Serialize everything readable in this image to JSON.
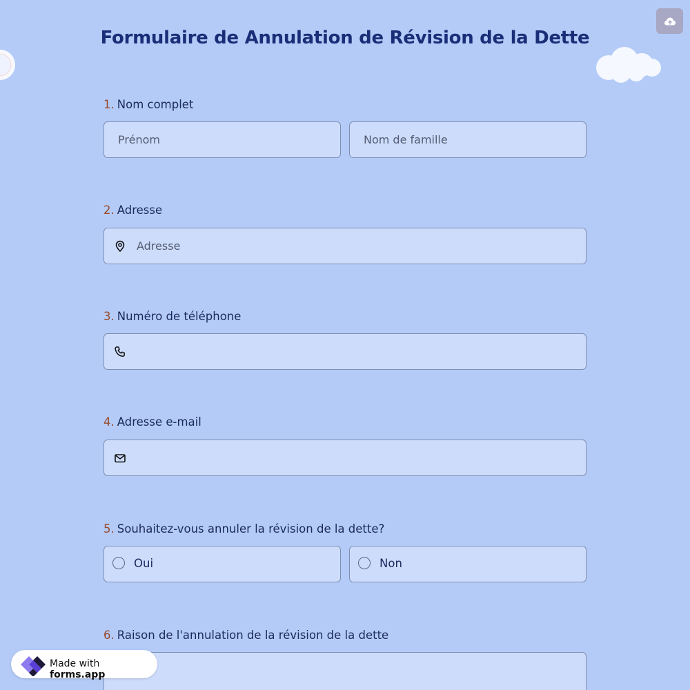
{
  "form": {
    "title": "Formulaire de Annulation de Révision de la Dette",
    "save_icon": "cloud-upload-icon"
  },
  "questions": [
    {
      "number": "1.",
      "label": "Nom complet",
      "first_name_placeholder": "Prénom",
      "last_name_placeholder": "Nom de famille"
    },
    {
      "number": "2.",
      "label": "Adresse",
      "placeholder": "Adresse",
      "icon": "map-pin-icon"
    },
    {
      "number": "3.",
      "label": "Numéro de téléphone",
      "placeholder": "",
      "icon": "phone-icon"
    },
    {
      "number": "4.",
      "label": "Adresse e-mail",
      "placeholder": "",
      "icon": "mail-icon"
    },
    {
      "number": "5.",
      "label": "Souhaitez-vous annuler la révision de la dette?",
      "options": [
        "Oui",
        "Non"
      ]
    },
    {
      "number": "6.",
      "label": "Raison de l'annulation de la révision de la dette"
    }
  ],
  "badge": {
    "made_with": "Made with",
    "brand": "forms.app"
  },
  "colors": {
    "background": "#b4cbf8",
    "field_background": "#cddcfb",
    "title": "#1a2e78",
    "number_accent": "#9a4a2a"
  }
}
